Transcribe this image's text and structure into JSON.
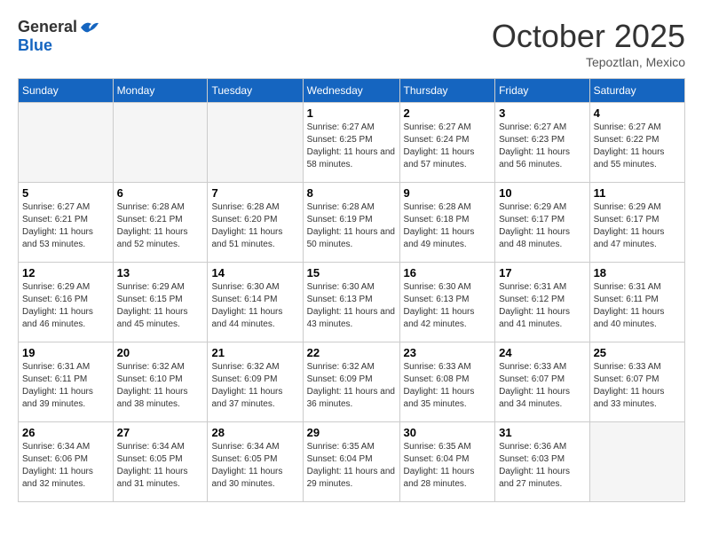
{
  "header": {
    "logo_general": "General",
    "logo_blue": "Blue",
    "month_title": "October 2025",
    "subtitle": "Tepoztlan, Mexico"
  },
  "calendar": {
    "days_of_week": [
      "Sunday",
      "Monday",
      "Tuesday",
      "Wednesday",
      "Thursday",
      "Friday",
      "Saturday"
    ],
    "weeks": [
      [
        {
          "day": "",
          "empty": true
        },
        {
          "day": "",
          "empty": true
        },
        {
          "day": "",
          "empty": true
        },
        {
          "day": "1",
          "sunrise": "6:27 AM",
          "sunset": "6:25 PM",
          "daylight": "11 hours and 58 minutes."
        },
        {
          "day": "2",
          "sunrise": "6:27 AM",
          "sunset": "6:24 PM",
          "daylight": "11 hours and 57 minutes."
        },
        {
          "day": "3",
          "sunrise": "6:27 AM",
          "sunset": "6:23 PM",
          "daylight": "11 hours and 56 minutes."
        },
        {
          "day": "4",
          "sunrise": "6:27 AM",
          "sunset": "6:22 PM",
          "daylight": "11 hours and 55 minutes."
        }
      ],
      [
        {
          "day": "5",
          "sunrise": "6:27 AM",
          "sunset": "6:21 PM",
          "daylight": "11 hours and 53 minutes."
        },
        {
          "day": "6",
          "sunrise": "6:28 AM",
          "sunset": "6:21 PM",
          "daylight": "11 hours and 52 minutes."
        },
        {
          "day": "7",
          "sunrise": "6:28 AM",
          "sunset": "6:20 PM",
          "daylight": "11 hours and 51 minutes."
        },
        {
          "day": "8",
          "sunrise": "6:28 AM",
          "sunset": "6:19 PM",
          "daylight": "11 hours and 50 minutes."
        },
        {
          "day": "9",
          "sunrise": "6:28 AM",
          "sunset": "6:18 PM",
          "daylight": "11 hours and 49 minutes."
        },
        {
          "day": "10",
          "sunrise": "6:29 AM",
          "sunset": "6:17 PM",
          "daylight": "11 hours and 48 minutes."
        },
        {
          "day": "11",
          "sunrise": "6:29 AM",
          "sunset": "6:17 PM",
          "daylight": "11 hours and 47 minutes."
        }
      ],
      [
        {
          "day": "12",
          "sunrise": "6:29 AM",
          "sunset": "6:16 PM",
          "daylight": "11 hours and 46 minutes."
        },
        {
          "day": "13",
          "sunrise": "6:29 AM",
          "sunset": "6:15 PM",
          "daylight": "11 hours and 45 minutes."
        },
        {
          "day": "14",
          "sunrise": "6:30 AM",
          "sunset": "6:14 PM",
          "daylight": "11 hours and 44 minutes."
        },
        {
          "day": "15",
          "sunrise": "6:30 AM",
          "sunset": "6:13 PM",
          "daylight": "11 hours and 43 minutes."
        },
        {
          "day": "16",
          "sunrise": "6:30 AM",
          "sunset": "6:13 PM",
          "daylight": "11 hours and 42 minutes."
        },
        {
          "day": "17",
          "sunrise": "6:31 AM",
          "sunset": "6:12 PM",
          "daylight": "11 hours and 41 minutes."
        },
        {
          "day": "18",
          "sunrise": "6:31 AM",
          "sunset": "6:11 PM",
          "daylight": "11 hours and 40 minutes."
        }
      ],
      [
        {
          "day": "19",
          "sunrise": "6:31 AM",
          "sunset": "6:11 PM",
          "daylight": "11 hours and 39 minutes."
        },
        {
          "day": "20",
          "sunrise": "6:32 AM",
          "sunset": "6:10 PM",
          "daylight": "11 hours and 38 minutes."
        },
        {
          "day": "21",
          "sunrise": "6:32 AM",
          "sunset": "6:09 PM",
          "daylight": "11 hours and 37 minutes."
        },
        {
          "day": "22",
          "sunrise": "6:32 AM",
          "sunset": "6:09 PM",
          "daylight": "11 hours and 36 minutes."
        },
        {
          "day": "23",
          "sunrise": "6:33 AM",
          "sunset": "6:08 PM",
          "daylight": "11 hours and 35 minutes."
        },
        {
          "day": "24",
          "sunrise": "6:33 AM",
          "sunset": "6:07 PM",
          "daylight": "11 hours and 34 minutes."
        },
        {
          "day": "25",
          "sunrise": "6:33 AM",
          "sunset": "6:07 PM",
          "daylight": "11 hours and 33 minutes."
        }
      ],
      [
        {
          "day": "26",
          "sunrise": "6:34 AM",
          "sunset": "6:06 PM",
          "daylight": "11 hours and 32 minutes."
        },
        {
          "day": "27",
          "sunrise": "6:34 AM",
          "sunset": "6:05 PM",
          "daylight": "11 hours and 31 minutes."
        },
        {
          "day": "28",
          "sunrise": "6:34 AM",
          "sunset": "6:05 PM",
          "daylight": "11 hours and 30 minutes."
        },
        {
          "day": "29",
          "sunrise": "6:35 AM",
          "sunset": "6:04 PM",
          "daylight": "11 hours and 29 minutes."
        },
        {
          "day": "30",
          "sunrise": "6:35 AM",
          "sunset": "6:04 PM",
          "daylight": "11 hours and 28 minutes."
        },
        {
          "day": "31",
          "sunrise": "6:36 AM",
          "sunset": "6:03 PM",
          "daylight": "11 hours and 27 minutes."
        },
        {
          "day": "",
          "empty": true
        }
      ]
    ]
  }
}
